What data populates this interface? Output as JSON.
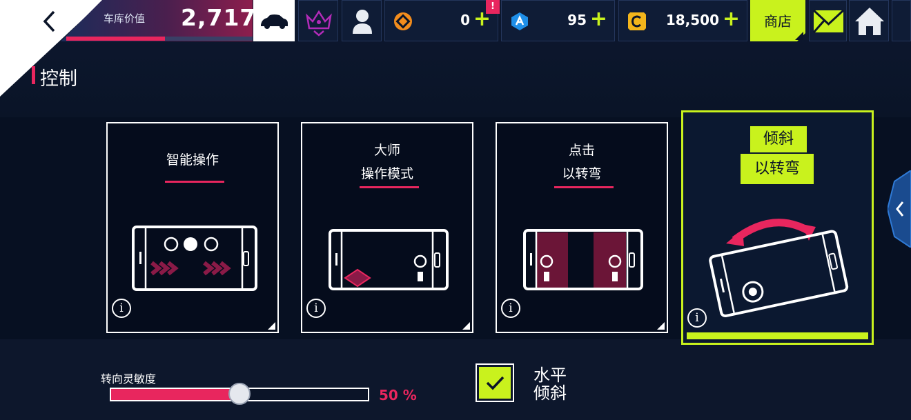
{
  "header": {
    "garage_label": "车库价值",
    "garage_value": "2,717",
    "garage_progress": 0.53,
    "notification_badge": "!",
    "currencies": [
      {
        "icon": "token-icon",
        "amount": "0",
        "plus": "+"
      },
      {
        "icon": "blueprint-icon",
        "amount": "95",
        "plus": "+"
      },
      {
        "icon": "credits-icon",
        "amount": "18,500",
        "plus": "+"
      }
    ],
    "shop_label": "商店"
  },
  "section": {
    "title": "控制"
  },
  "cards": [
    {
      "name": "smart-control",
      "title_line1": "",
      "title_line2": "智能操作",
      "info": "i",
      "selected": false
    },
    {
      "name": "master-control",
      "title_line1": "大师",
      "title_line2": "操作模式",
      "info": "i",
      "selected": false
    },
    {
      "name": "tap-to-steer",
      "title_line1": "点击",
      "title_line2": "以转弯",
      "info": "i",
      "selected": false
    },
    {
      "name": "tilt-to-steer",
      "title_line1": "倾斜",
      "title_line2": "以转弯",
      "info": "i",
      "selected": true
    }
  ],
  "sensitivity": {
    "label": "转向灵敏度",
    "percent": 50,
    "value_text": "50 %"
  },
  "horizontal_tilt": {
    "label_line1": "水平",
    "label_line2": "倾斜",
    "checked": true
  },
  "colors": {
    "accent_pink": "#e8265e",
    "accent_lime": "#c9f21d",
    "background": "#0b1428"
  }
}
